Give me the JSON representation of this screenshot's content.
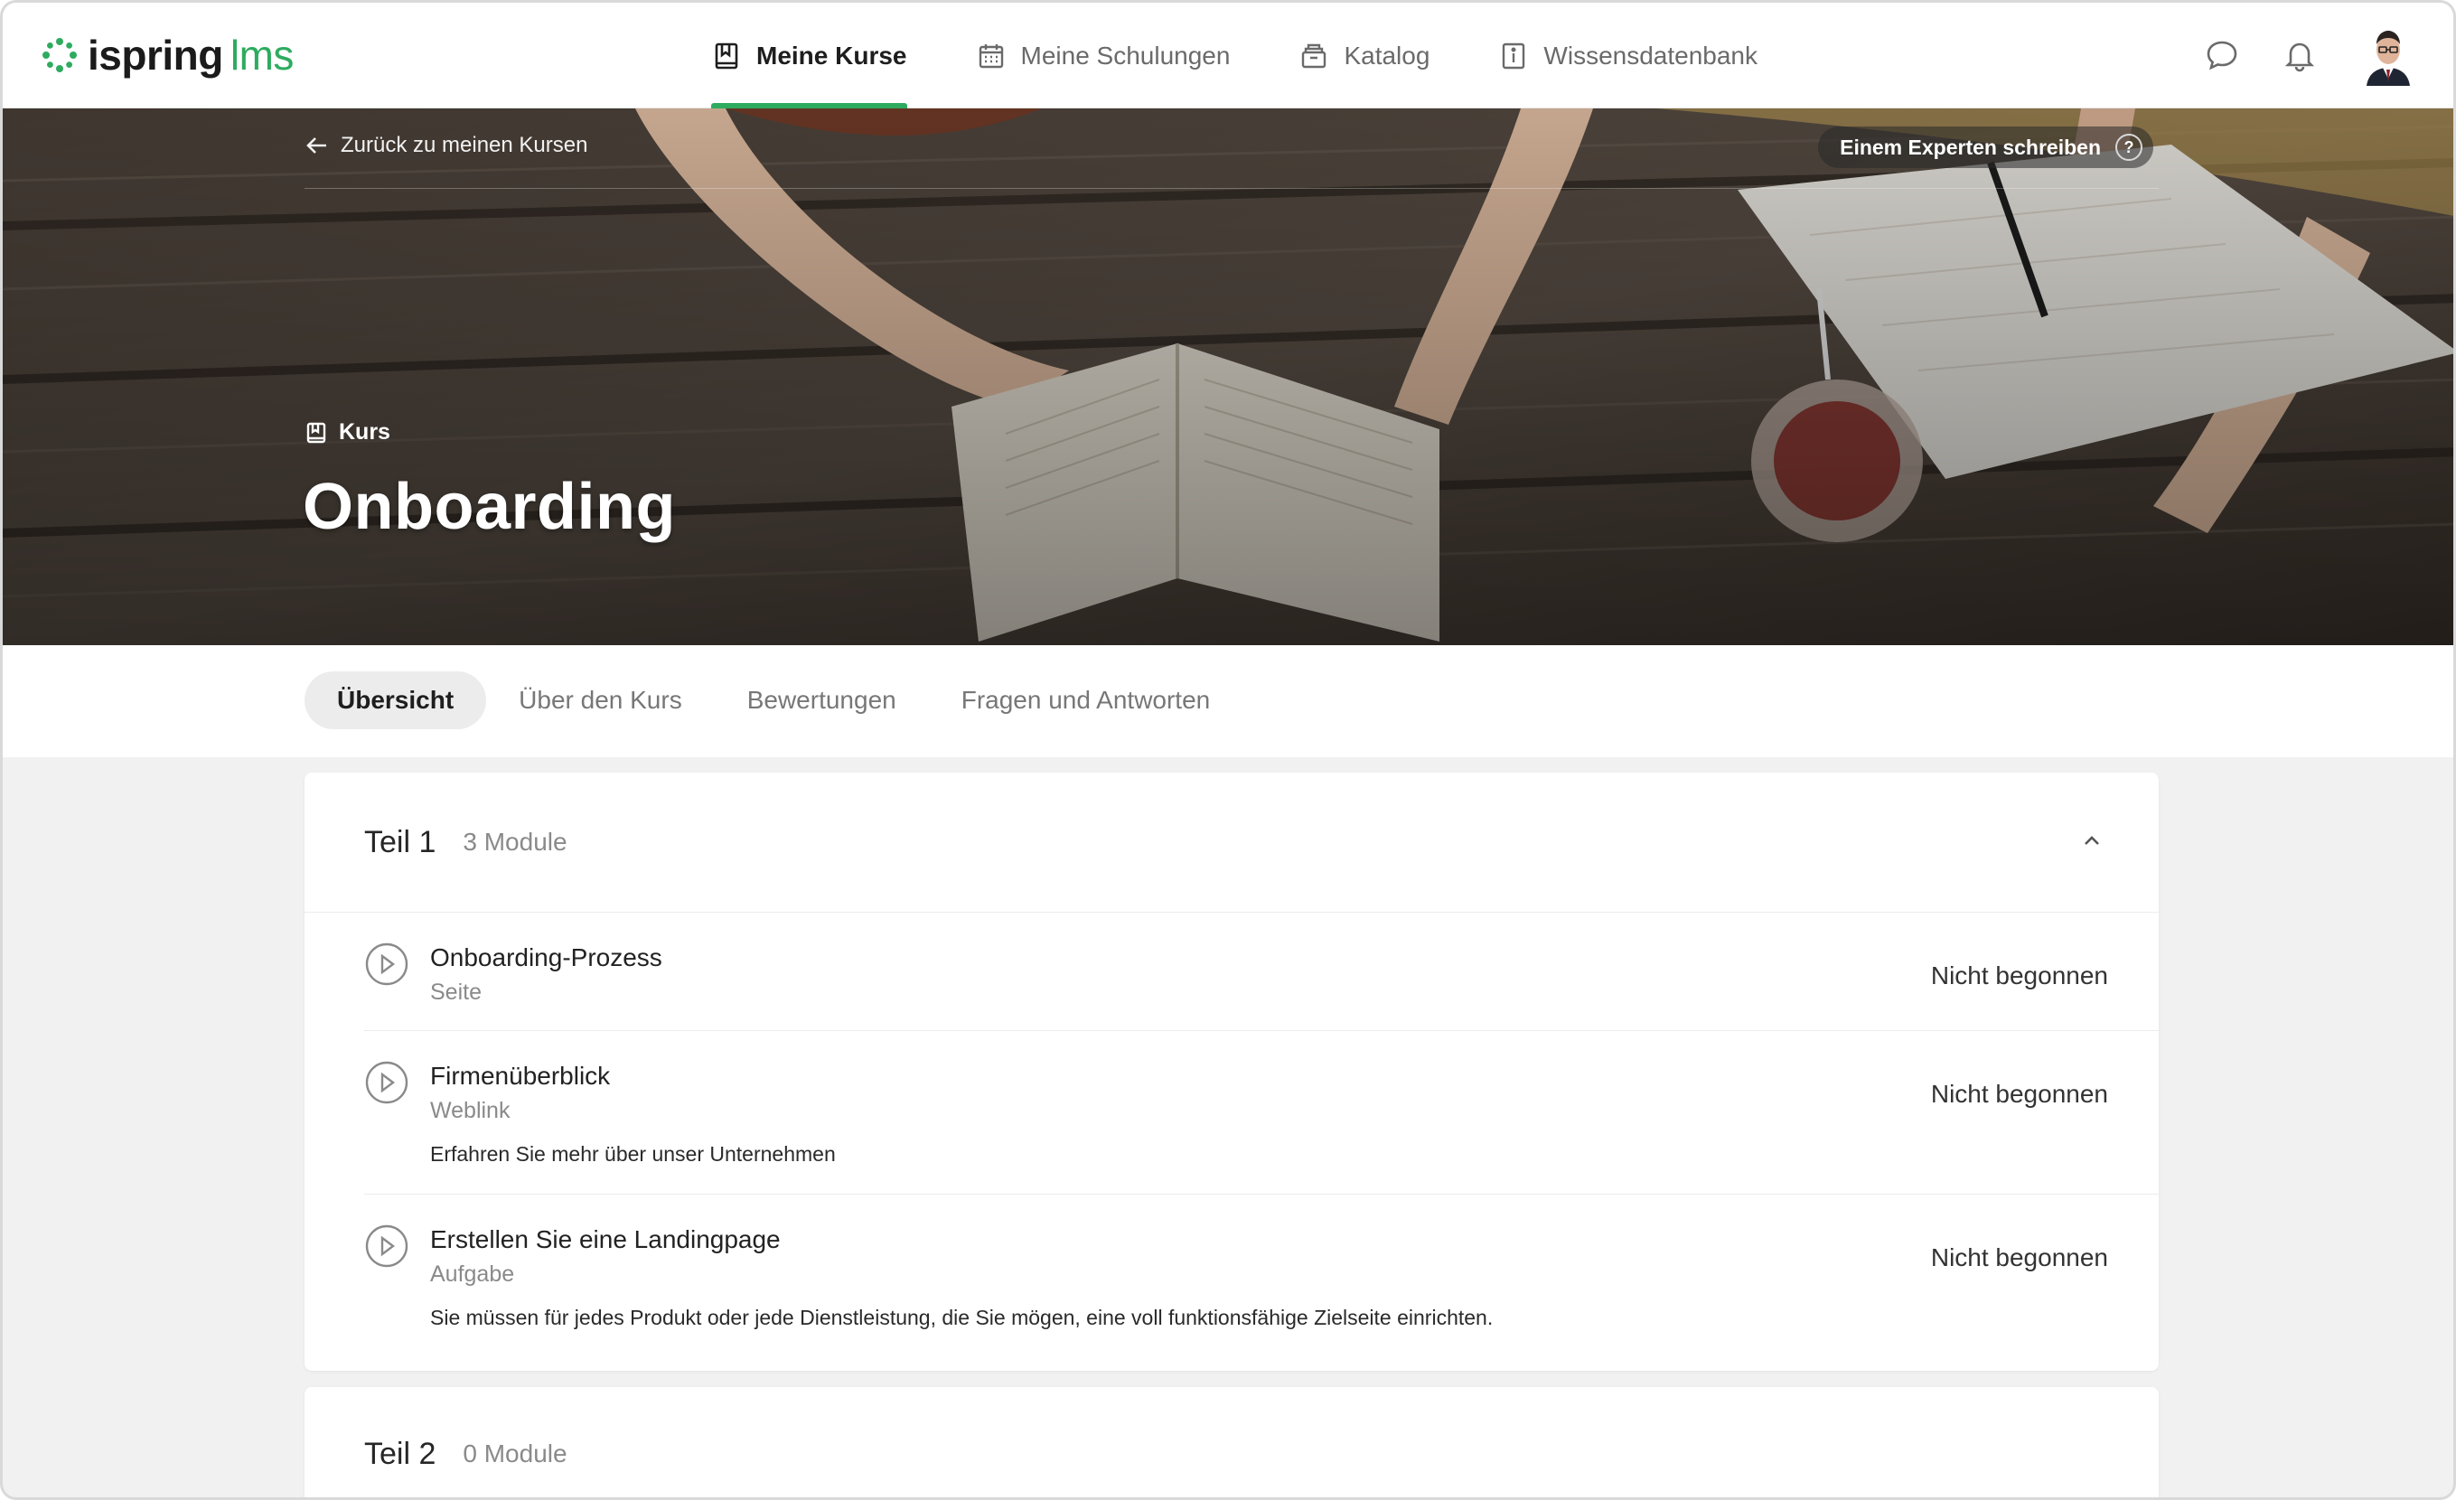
{
  "brand": {
    "name_bold": "ispring",
    "name_light": "lms",
    "accent": "#2eab5f"
  },
  "nav": {
    "items": [
      {
        "label": "Meine Kurse",
        "icon": "book-icon",
        "active": true
      },
      {
        "label": "Meine Schulungen",
        "icon": "calendar-icon",
        "active": false
      },
      {
        "label": "Katalog",
        "icon": "catalog-icon",
        "active": false
      },
      {
        "label": "Wissensdatenbank",
        "icon": "info-book-icon",
        "active": false
      }
    ]
  },
  "header_icons": [
    "chat-icon",
    "bell-icon",
    "avatar"
  ],
  "hero": {
    "back_label": "Zurück zu meinen Kursen",
    "expert_label": "Einem Experten schreiben",
    "expert_help": "?",
    "kind_label": "Kurs",
    "title": "Onboarding"
  },
  "tabs": [
    {
      "label": "Übersicht",
      "active": true
    },
    {
      "label": "Über den Kurs",
      "active": false
    },
    {
      "label": "Bewertungen",
      "active": false
    },
    {
      "label": "Fragen und Antworten",
      "active": false
    }
  ],
  "sections": [
    {
      "title": "Teil 1",
      "count": "3 Module",
      "modules": [
        {
          "title": "Onboarding-Prozess",
          "type": "Seite",
          "description": "",
          "status": "Nicht begonnen"
        },
        {
          "title": "Firmenüberblick",
          "type": "Weblink",
          "description": "Erfahren Sie mehr über unser Unternehmen",
          "status": "Nicht begonnen"
        },
        {
          "title": "Erstellen Sie eine Landingpage",
          "type": "Aufgabe",
          "description": "Sie müssen für jedes Produkt oder jede Dienstleistung, die Sie mögen, eine voll funktionsfähige Zielseite einrichten.",
          "status": "Nicht begonnen"
        }
      ]
    },
    {
      "title": "Teil 2",
      "count": "0 Module",
      "modules": []
    }
  ]
}
